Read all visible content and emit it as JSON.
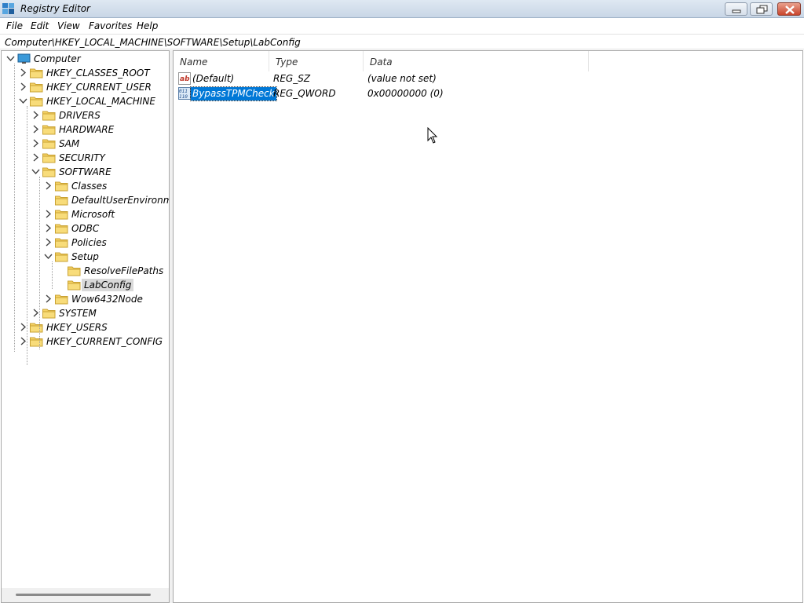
{
  "window": {
    "title": "Registry Editor",
    "icon": "registry-editor-icon"
  },
  "menu": [
    "File",
    "Edit",
    "View",
    "Favorites",
    "Help"
  ],
  "address": "Computer\\HKEY_LOCAL_MACHINE\\SOFTWARE\\Setup\\LabConfig",
  "tree": [
    {
      "label": "Computer",
      "depth": 0,
      "expander": "open",
      "icon": "computer-icon"
    },
    {
      "label": "HKEY_CLASSES_ROOT",
      "depth": 1,
      "expander": "closed",
      "icon": "folder-icon"
    },
    {
      "label": "HKEY_CURRENT_USER",
      "depth": 1,
      "expander": "closed",
      "icon": "folder-icon"
    },
    {
      "label": "HKEY_LOCAL_MACHINE",
      "depth": 1,
      "expander": "open",
      "icon": "folder-icon"
    },
    {
      "label": "DRIVERS",
      "depth": 2,
      "expander": "closed",
      "icon": "folder-icon"
    },
    {
      "label": "HARDWARE",
      "depth": 2,
      "expander": "closed",
      "icon": "folder-icon"
    },
    {
      "label": "SAM",
      "depth": 2,
      "expander": "closed",
      "icon": "folder-icon"
    },
    {
      "label": "SECURITY",
      "depth": 2,
      "expander": "closed",
      "icon": "folder-icon"
    },
    {
      "label": "SOFTWARE",
      "depth": 2,
      "expander": "open",
      "icon": "folder-icon"
    },
    {
      "label": "Classes",
      "depth": 3,
      "expander": "closed",
      "icon": "folder-icon"
    },
    {
      "label": "DefaultUserEnvironment",
      "depth": 3,
      "expander": "none",
      "icon": "folder-icon"
    },
    {
      "label": "Microsoft",
      "depth": 3,
      "expander": "closed",
      "icon": "folder-icon"
    },
    {
      "label": "ODBC",
      "depth": 3,
      "expander": "closed",
      "icon": "folder-icon"
    },
    {
      "label": "Policies",
      "depth": 3,
      "expander": "closed",
      "icon": "folder-icon"
    },
    {
      "label": "Setup",
      "depth": 3,
      "expander": "open",
      "icon": "folder-icon"
    },
    {
      "label": "ResolveFilePaths",
      "depth": 4,
      "expander": "none",
      "icon": "folder-icon"
    },
    {
      "label": "LabConfig",
      "depth": 4,
      "expander": "none",
      "icon": "folder-icon",
      "selected": true
    },
    {
      "label": "Wow6432Node",
      "depth": 3,
      "expander": "closed",
      "icon": "folder-icon"
    },
    {
      "label": "SYSTEM",
      "depth": 2,
      "expander": "closed",
      "icon": "folder-icon"
    },
    {
      "label": "HKEY_USERS",
      "depth": 1,
      "expander": "closed",
      "icon": "folder-icon"
    },
    {
      "label": "HKEY_CURRENT_CONFIG",
      "depth": 1,
      "expander": "closed",
      "icon": "folder-icon"
    }
  ],
  "columns": {
    "name": "Name",
    "type": "Type",
    "data": "Data"
  },
  "values": [
    {
      "name": "(Default)",
      "type": "REG_SZ",
      "data": "(value not set)",
      "icon": "string-value-icon",
      "selected": false
    },
    {
      "name": "BypassTPMCheck",
      "type": "REG_QWORD",
      "data": "0x00000000 (0)",
      "icon": "binary-value-icon",
      "selected": true
    }
  ],
  "colors": {
    "selection": "#0078d7",
    "folder": "#f6d365",
    "tree_selection": "#d9d9d9"
  }
}
